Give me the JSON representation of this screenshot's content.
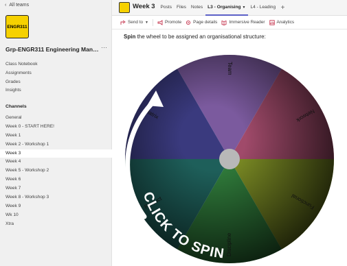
{
  "sidebar": {
    "back_label": "All teams",
    "team_logo_text": "ENGR311",
    "team_name": "Grp-ENGR311 Engineering Management",
    "more_glyph": "···",
    "nav_items": [
      "Class Notebook",
      "Assignments",
      "Grades",
      "Insights"
    ],
    "channels_heading": "Channels",
    "channels": [
      "General",
      "Week 0 - START HERE!",
      "Week 1",
      "Week 2 - Workshop 1",
      "Week 3",
      "Week 4",
      "Week 5 - Workshop 2",
      "Week 6",
      "Week 7",
      "Week 8 - Workshop 3",
      "Week 9",
      "Wk 10",
      "Xtra"
    ],
    "active_channel": "Week 3"
  },
  "header": {
    "title": "Week 3",
    "tabs": [
      "Posts",
      "Files",
      "Notes",
      "L3 - Organising",
      "L4 - Leading"
    ],
    "active_tab": "L3 - Organising",
    "add_glyph": "+"
  },
  "toolbar": {
    "send_to": "Send to",
    "promote": "Promote",
    "page_details": "Page details",
    "immersive_reader": "Immersive Reader",
    "analytics": "Analytics"
  },
  "content": {
    "instruction_bold": "Spin",
    "instruction_rest": " the wheel to be assigned an organisational structure:",
    "cta": "CLICK TO SPIN"
  },
  "wheel": {
    "segments": [
      {
        "label": "Team",
        "color": "#7b5a9e"
      },
      {
        "label": "Network",
        "color": "#a04a6a"
      },
      {
        "label": "Functional",
        "color": "#7a8a24"
      },
      {
        "label": "Discipline",
        "color": "#2f7a3a"
      },
      {
        "label": "Product",
        "color": "#1e5f5a"
      },
      {
        "label": "Matrix",
        "color": "#3a3a7e"
      }
    ]
  },
  "colors": {
    "accent": "#5b5fc7",
    "team_logo_bg": "#f6d100"
  }
}
